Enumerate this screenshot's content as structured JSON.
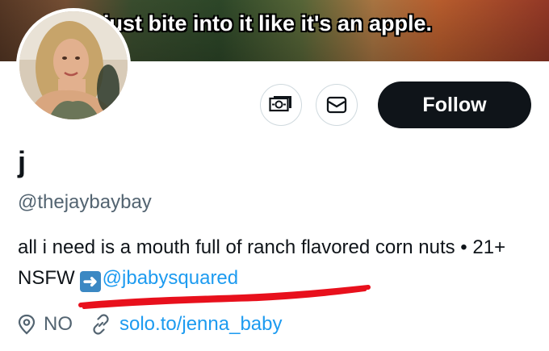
{
  "banner": {
    "caption": "just bite into it like it's an apple."
  },
  "profile": {
    "name": "j",
    "handle": "@thejaybaybay",
    "bio_text": "all i need is a mouth full of ranch flavored corn nuts • 21+ NSFW",
    "bio_mention": "@jbabysquared",
    "location": "NO",
    "website": "solo.to/jenna_baby"
  },
  "actions": {
    "follow_label": "Follow"
  },
  "icons": {
    "tip": "money-icon",
    "message": "envelope-icon",
    "location": "location-pin-icon",
    "link": "link-icon",
    "arrow": "right-arrow-emoji"
  },
  "colors": {
    "link": "#1d9bf0",
    "annotation": "#e8101c",
    "follow_bg": "#0f1419"
  }
}
